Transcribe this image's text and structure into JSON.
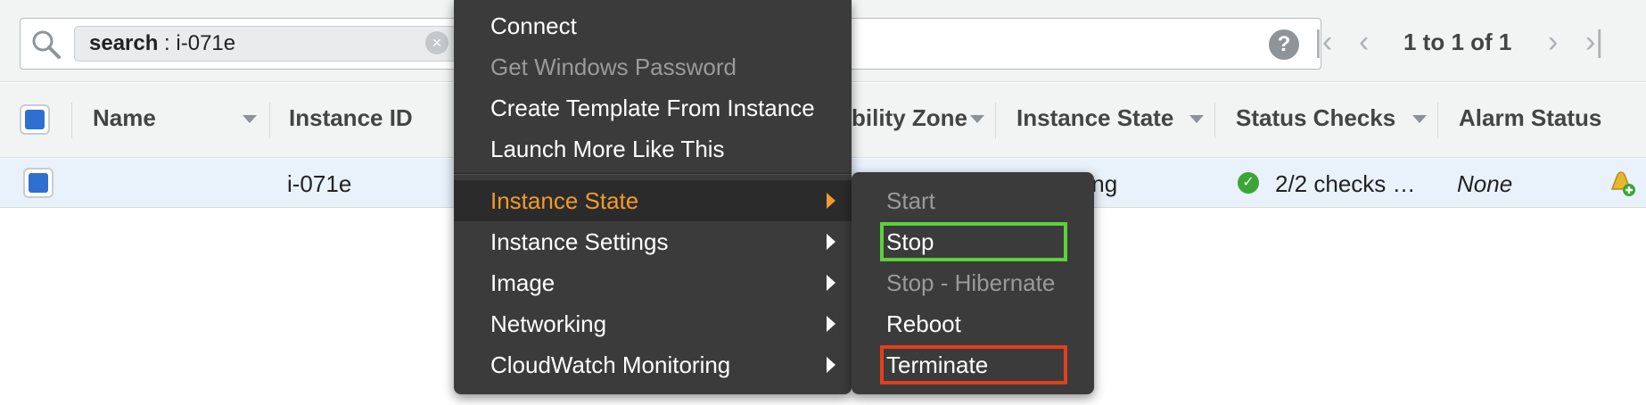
{
  "search": {
    "token_key": "search",
    "token_sep": " : ",
    "token_value": "i-071e",
    "clear_glyph": "×"
  },
  "help": {
    "glyph": "?"
  },
  "pagination": {
    "text": "1 to 1 of 1",
    "first_glyph": "|‹",
    "prev_glyph": "‹",
    "next_glyph": "›",
    "last_glyph": "›|"
  },
  "table": {
    "columns": [
      "Name",
      "Instance ID",
      "bility Zone",
      "Instance State",
      "Status Checks",
      "Alarm Status"
    ],
    "row": {
      "name": "",
      "instance_id": "i-071e",
      "instance_state": "ning",
      "status_checks": "2/2 checks …",
      "alarm_status": "None"
    }
  },
  "context_menu": {
    "items": [
      {
        "label": "Connect",
        "state": "enabled"
      },
      {
        "label": "Get Windows Password",
        "state": "disabled"
      },
      {
        "label": "Create Template From Instance",
        "state": "enabled"
      },
      {
        "label": "Launch More Like This",
        "state": "enabled"
      },
      {
        "label": "Instance State",
        "state": "active",
        "submenu": true
      },
      {
        "label": "Instance Settings",
        "state": "enabled",
        "submenu": true
      },
      {
        "label": "Image",
        "state": "enabled",
        "submenu": true
      },
      {
        "label": "Networking",
        "state": "enabled",
        "submenu": true
      },
      {
        "label": "CloudWatch Monitoring",
        "state": "enabled",
        "submenu": true
      }
    ]
  },
  "instance_state_submenu": {
    "items": [
      {
        "label": "Start",
        "state": "disabled"
      },
      {
        "label": "Stop",
        "state": "enabled",
        "highlight": "green"
      },
      {
        "label": "Stop - Hibernate",
        "state": "disabled"
      },
      {
        "label": "Reboot",
        "state": "enabled"
      },
      {
        "label": "Terminate",
        "state": "enabled",
        "highlight": "red"
      }
    ]
  },
  "colors": {
    "accent_orange": "#f09a2f",
    "highlight_green": "#5cd13c",
    "highlight_red": "#e0401c",
    "checkbox_blue": "#2f6fd0",
    "row_selected": "#e9f1fb"
  },
  "icons": {
    "search": "magnifier-icon",
    "help": "question-circle-icon",
    "status_ok": "check-circle-icon",
    "alarm": "alarm-bell-add-icon"
  }
}
